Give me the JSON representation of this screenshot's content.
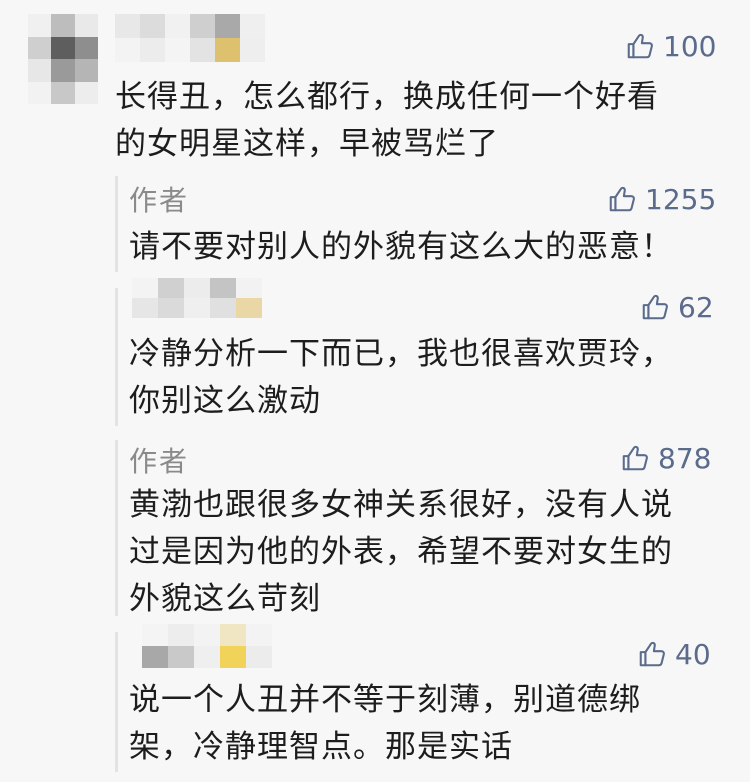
{
  "comments": [
    {
      "likes": "100",
      "lines": [
        "长得丑，怎么都行，换成任何一个好看",
        "的女明星这样，早被骂烂了"
      ]
    }
  ],
  "replies": [
    {
      "author": "作者",
      "likes": "1255",
      "lines": [
        "请不要对别人的外貌有这么大的恶意！"
      ]
    },
    {
      "author": "",
      "likes": "62",
      "lines": [
        "冷静分析一下而已，我也很喜欢贾玲，",
        "你别这么激动"
      ]
    },
    {
      "author": "作者",
      "likes": "878",
      "lines": [
        "黄渤也跟很多女神关系很好，没有人说",
        "过是因为他的外表，希望不要对女生的",
        "外貌这么苛刻"
      ]
    },
    {
      "author": "",
      "likes": "40",
      "lines": [
        "说一个人丑并不等于刻薄，别道德绑",
        "架，冷静理智点。那是实话"
      ]
    }
  ],
  "colors": {
    "background": "#f7f7f7",
    "like": "#5a6b8c",
    "author": "#8a8a8a"
  },
  "icons": {
    "like": "thumbs-up-icon"
  }
}
